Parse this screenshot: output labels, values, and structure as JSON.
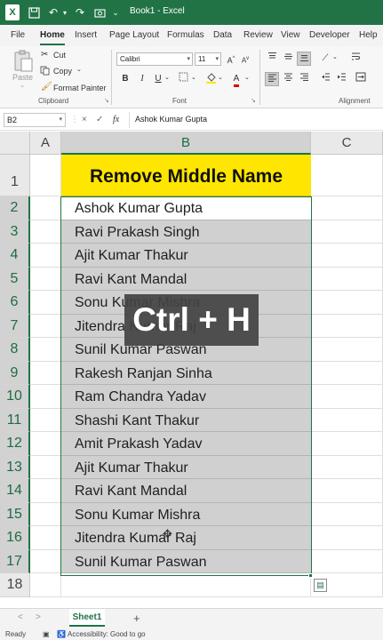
{
  "titlebar": {
    "title": "Book1 - Excel",
    "icons": [
      "excel-logo",
      "save-icon",
      "undo-icon",
      "redo-icon",
      "camera-icon",
      "customize-icon"
    ]
  },
  "menu": {
    "tabs": [
      "File",
      "Home",
      "Insert",
      "Page Layout",
      "Formulas",
      "Data",
      "Review",
      "View",
      "Developer",
      "Help"
    ],
    "active": "Home"
  },
  "ribbon": {
    "clipboard": {
      "paste": "Paste",
      "cut": "Cut",
      "copy": "Copy",
      "format_painter": "Format Painter",
      "label": "Clipboard"
    },
    "font": {
      "name": "Calibri",
      "size": "11",
      "bold": "B",
      "italic": "I",
      "underline": "U",
      "label": "Font"
    },
    "alignment": {
      "label": "Alignment"
    }
  },
  "formula_bar": {
    "name_box": "B2",
    "cancel": "×",
    "enter": "✓",
    "fx": "fx",
    "value": "Ashok Kumar Gupta"
  },
  "sheet": {
    "columns": [
      "A",
      "B",
      "C"
    ],
    "rows": [
      "1",
      "2",
      "3",
      "4",
      "5",
      "6",
      "7",
      "8",
      "9",
      "10",
      "11",
      "12",
      "13",
      "14",
      "15",
      "16",
      "17",
      "18"
    ],
    "header": "Remove Middle Name",
    "names": [
      "Ashok Kumar Gupta",
      "Ravi Prakash Singh",
      "Ajit Kumar Thakur",
      "Ravi Kant Mandal",
      "Sonu Kumar Mishra",
      "Jitendra Kumar Raj",
      "Sunil Kumar Paswan",
      "Rakesh Ranjan Sinha",
      "Ram Chandra Yadav",
      "Shashi Kant Thakur",
      "Amit Prakash Yadav",
      "Ajit Kumar Thakur",
      "Ravi Kant Mandal",
      "Sonu Kumar Mishra",
      "Jitendra Kumar Raj",
      "Sunil Kumar Paswan"
    ]
  },
  "overlay": {
    "text": "Ctrl + H"
  },
  "sheet_tabs": {
    "tab": "Sheet1",
    "add": "+"
  },
  "status": {
    "ready": "Ready",
    "accessibility": "Accessibility: Good to go"
  },
  "colors": {
    "excel_green": "#217346",
    "header_fill": "#ffe600",
    "selection_fill": "#d0d0d0"
  }
}
